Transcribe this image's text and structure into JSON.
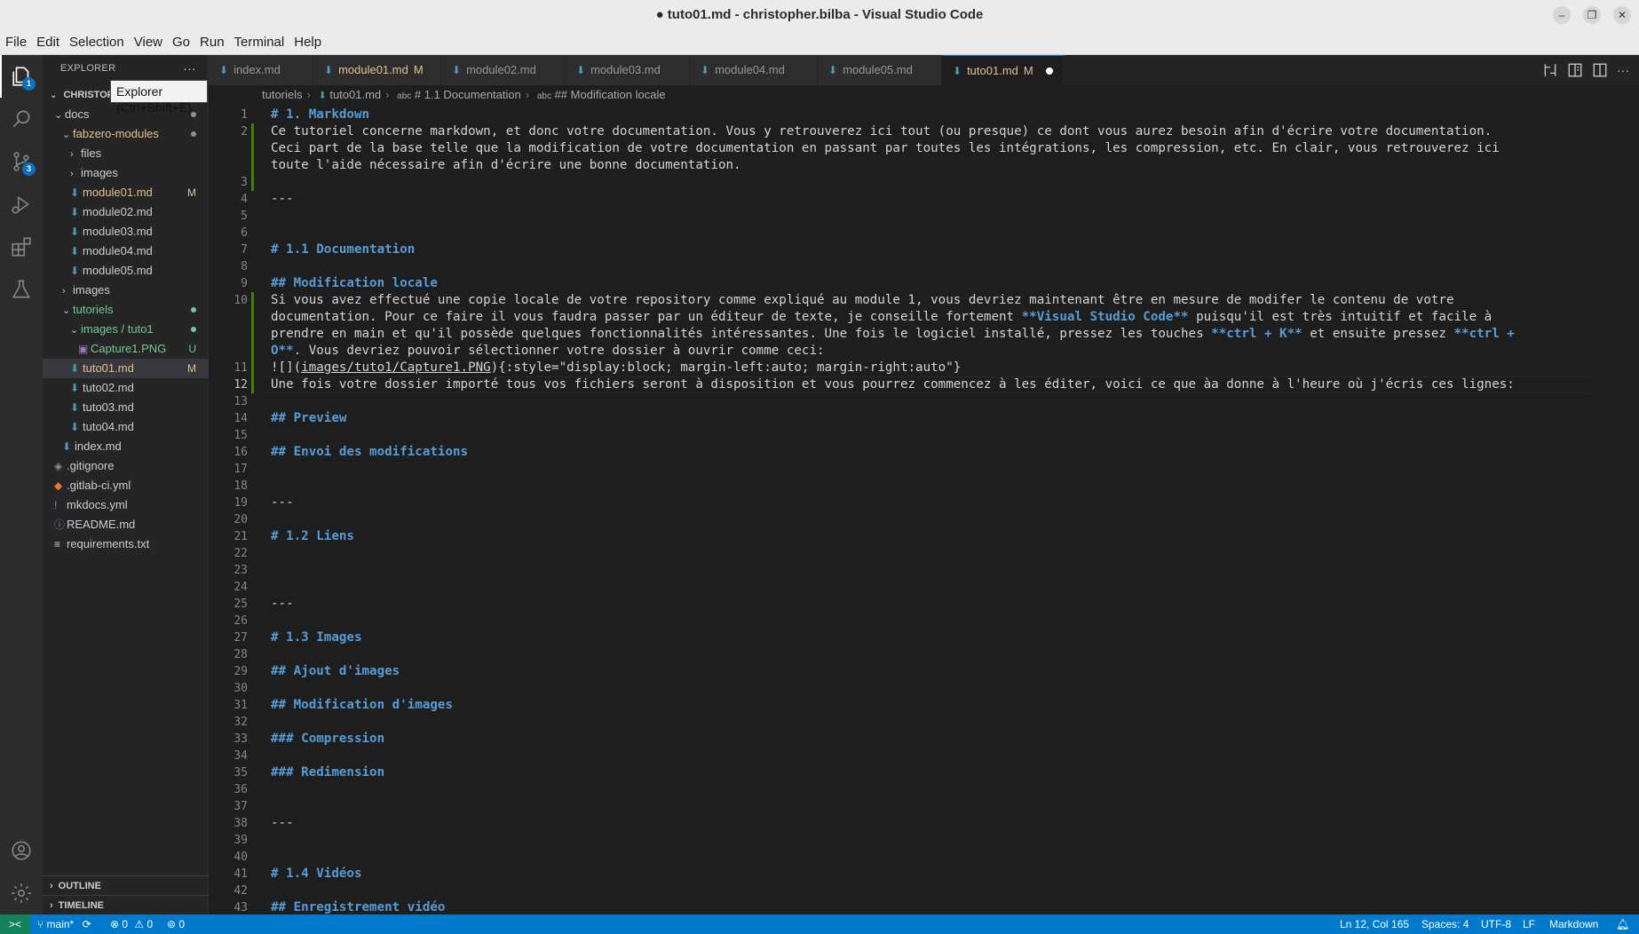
{
  "window": {
    "title": "● tuto01.md - christopher.bilba - Visual Studio Code",
    "controls": {
      "minimize": "–",
      "restore": "❐",
      "close": "✕"
    }
  },
  "menu": [
    "File",
    "Edit",
    "Selection",
    "View",
    "Go",
    "Run",
    "Terminal",
    "Help"
  ],
  "activity": {
    "explorer_badge": "1",
    "scm_badge": "3"
  },
  "sidebar": {
    "title": "EXPLORER",
    "more": "···",
    "root": "CHRISTOP",
    "tooltip": "Explorer (Ctrl+Shift+E)",
    "tree": [
      {
        "label": "docs",
        "indent": 1,
        "folder": true,
        "open": true,
        "dot": "#8f8f8f"
      },
      {
        "label": "fabzero-modules",
        "indent": 2,
        "folder": true,
        "open": true,
        "dot": "#8f8f8f",
        "color": "#e2c08d"
      },
      {
        "label": "files",
        "indent": 3,
        "folder": true,
        "open": false
      },
      {
        "label": "images",
        "indent": 3,
        "folder": true,
        "open": false
      },
      {
        "label": "module01.md",
        "indent": 3,
        "status": "M",
        "color": "#e2c08d"
      },
      {
        "label": "module02.md",
        "indent": 3
      },
      {
        "label": "module03.md",
        "indent": 3
      },
      {
        "label": "module04.md",
        "indent": 3
      },
      {
        "label": "module05.md",
        "indent": 3
      },
      {
        "label": "images",
        "indent": 2,
        "folder": true,
        "open": false
      },
      {
        "label": "tutoriels",
        "indent": 2,
        "folder": true,
        "open": true,
        "dot": "#73c991",
        "color": "#73c991"
      },
      {
        "label": "images / tuto1",
        "indent": 3,
        "folder": true,
        "open": true,
        "dot": "#73c991",
        "color": "#73c991"
      },
      {
        "label": "Capture1.PNG",
        "indent": 4,
        "status": "U",
        "color": "#73c991",
        "image": true
      },
      {
        "label": "tuto01.md",
        "indent": 3,
        "status": "M",
        "color": "#e2c08d",
        "selected": true
      },
      {
        "label": "tuto02.md",
        "indent": 3
      },
      {
        "label": "tuto03.md",
        "indent": 3
      },
      {
        "label": "tuto04.md",
        "indent": 3
      },
      {
        "label": "index.md",
        "indent": 2
      },
      {
        "label": ".gitignore",
        "indent": 1,
        "icon": "◈",
        "iconColor": "#8f8f8f"
      },
      {
        "label": ".gitlab-ci.yml",
        "indent": 1,
        "icon": "◆",
        "iconColor": "#e37933"
      },
      {
        "label": "mkdocs.yml",
        "indent": 1,
        "icon": "!",
        "iconColor": "#a074c4"
      },
      {
        "label": "README.md",
        "indent": 1,
        "icon": "ⓘ",
        "iconColor": "#519aba"
      },
      {
        "label": "requirements.txt",
        "indent": 1,
        "icon": "≡",
        "iconColor": "#cccccc"
      }
    ],
    "outline": "OUTLINE",
    "timeline": "TIMELINE"
  },
  "tabs": [
    {
      "label": "index.md",
      "modified": false
    },
    {
      "label": "module01.md",
      "modified": true
    },
    {
      "label": "module02.md",
      "modified": false
    },
    {
      "label": "module03.md",
      "modified": false
    },
    {
      "label": "module04.md",
      "modified": false
    },
    {
      "label": "module05.md",
      "modified": false
    },
    {
      "label": "tuto01.md",
      "modified": true,
      "active": true,
      "dirty": true
    }
  ],
  "tab_modified_marker": "M",
  "breadcrumb": [
    "tutoriels",
    "tuto01.md",
    "# 1.1 Documentation",
    "## Modification locale"
  ],
  "editor": {
    "current_line": 12,
    "lines": [
      {
        "n": "1",
        "parts": [
          {
            "t": "# 1. Markdown",
            "c": "h"
          }
        ]
      },
      {
        "n": "2",
        "parts": [
          {
            "t": "Ce tutoriel concerne markdown, et donc votre documentation. Vous y retrouverez ici tout (ou presque) ce dont vous aurez besoin afin d'écrire votre documentation."
          }
        ]
      },
      {
        "n": "",
        "parts": [
          {
            "t": "Ceci part de la base telle que la modification de votre documentation en passant par toutes les intégrations, les compression, etc. En clair, vous retrouverez ici"
          }
        ]
      },
      {
        "n": "",
        "parts": [
          {
            "t": "toute l'aide nécessaire afin d'écrire une bonne documentation."
          }
        ]
      },
      {
        "n": "3",
        "parts": []
      },
      {
        "n": "4",
        "parts": [
          {
            "t": "---"
          }
        ]
      },
      {
        "n": "5",
        "parts": []
      },
      {
        "n": "6",
        "parts": []
      },
      {
        "n": "7",
        "parts": [
          {
            "t": "# 1.1 Documentation",
            "c": "h"
          }
        ]
      },
      {
        "n": "8",
        "parts": []
      },
      {
        "n": "9",
        "parts": [
          {
            "t": "## Modification locale",
            "c": "h"
          }
        ]
      },
      {
        "n": "10",
        "parts": [
          {
            "t": "Si vous avez effectué une copie locale de votre repository comme expliqué au module 1, vous devriez maintenant être en mesure de modifer le contenu de votre"
          }
        ]
      },
      {
        "n": "",
        "parts": [
          {
            "t": "documentation. Pour ce faire il vous faudra passer par un éditeur de texte, je conseille fortement "
          },
          {
            "t": "**Visual Studio Code**",
            "c": "b"
          },
          {
            "t": " puisqu'il est très intuitif et facile à"
          }
        ]
      },
      {
        "n": "",
        "parts": [
          {
            "t": "prendre en main et qu'il possède quelques fonctionnalités intéressantes. Une fois le logiciel installé, pressez les touches "
          },
          {
            "t": "**ctrl + K**",
            "c": "b"
          },
          {
            "t": " et ensuite pressez "
          },
          {
            "t": "**ctrl +",
            "c": "b"
          }
        ]
      },
      {
        "n": "",
        "parts": [
          {
            "t": "O**",
            "c": "b"
          },
          {
            "t": ". Vous devriez pouvoir sélectionner votre dossier à ouvrir comme ceci:"
          }
        ]
      },
      {
        "n": "11",
        "parts": [
          {
            "t": "![]("
          },
          {
            "t": "images/tuto1/Capture1.PNG",
            "c": "link"
          },
          {
            "t": "){:style=\"display:block; margin-left:auto; margin-right:auto\"}"
          }
        ]
      },
      {
        "n": "12",
        "parts": [
          {
            "t": "Une fois votre dossier importé tous vos fichiers seront à disposition et vous pourrez commencez à les éditer, voici ce que àa donne à l'heure où j'écris ces lignes:"
          }
        ],
        "current": true
      },
      {
        "n": "13",
        "parts": []
      },
      {
        "n": "14",
        "parts": [
          {
            "t": "## Preview",
            "c": "h"
          }
        ]
      },
      {
        "n": "15",
        "parts": []
      },
      {
        "n": "16",
        "parts": [
          {
            "t": "## Envoi des modifications",
            "c": "h"
          }
        ]
      },
      {
        "n": "17",
        "parts": []
      },
      {
        "n": "18",
        "parts": []
      },
      {
        "n": "19",
        "parts": [
          {
            "t": "---"
          }
        ]
      },
      {
        "n": "20",
        "parts": []
      },
      {
        "n": "21",
        "parts": [
          {
            "t": "# 1.2 Liens",
            "c": "h"
          }
        ]
      },
      {
        "n": "22",
        "parts": []
      },
      {
        "n": "23",
        "parts": []
      },
      {
        "n": "24",
        "parts": []
      },
      {
        "n": "25",
        "parts": [
          {
            "t": "---"
          }
        ]
      },
      {
        "n": "26",
        "parts": []
      },
      {
        "n": "27",
        "parts": [
          {
            "t": "# 1.3 Images",
            "c": "h"
          }
        ]
      },
      {
        "n": "28",
        "parts": []
      },
      {
        "n": "29",
        "parts": [
          {
            "t": "## Ajout d'images",
            "c": "h"
          }
        ]
      },
      {
        "n": "30",
        "parts": []
      },
      {
        "n": "31",
        "parts": [
          {
            "t": "## Modification d'images",
            "c": "h"
          }
        ]
      },
      {
        "n": "32",
        "parts": []
      },
      {
        "n": "33",
        "parts": [
          {
            "t": "### Compression",
            "c": "h"
          }
        ]
      },
      {
        "n": "34",
        "parts": []
      },
      {
        "n": "35",
        "parts": [
          {
            "t": "### Redimension",
            "c": "h"
          }
        ]
      },
      {
        "n": "36",
        "parts": []
      },
      {
        "n": "37",
        "parts": []
      },
      {
        "n": "38",
        "parts": [
          {
            "t": "---"
          }
        ]
      },
      {
        "n": "39",
        "parts": []
      },
      {
        "n": "40",
        "parts": []
      },
      {
        "n": "41",
        "parts": [
          {
            "t": "# 1.4 Vidéos",
            "c": "h"
          }
        ]
      },
      {
        "n": "42",
        "parts": []
      },
      {
        "n": "43",
        "parts": [
          {
            "t": "## Enregistrement vidéo",
            "c": "h"
          }
        ]
      }
    ]
  },
  "statusbar": {
    "remote": "><",
    "branch": "main*",
    "sync": "⟳",
    "errors": "0",
    "warnings": "0",
    "ports": "0",
    "position": "Ln 12, Col 165",
    "spaces": "Spaces: 4",
    "encoding": "UTF-8",
    "eol": "LF",
    "language": "Markdown"
  },
  "colors": {
    "accent": "#007acc",
    "modified": "#e2c08d",
    "untracked": "#73c991",
    "heading": "#569cd6"
  }
}
